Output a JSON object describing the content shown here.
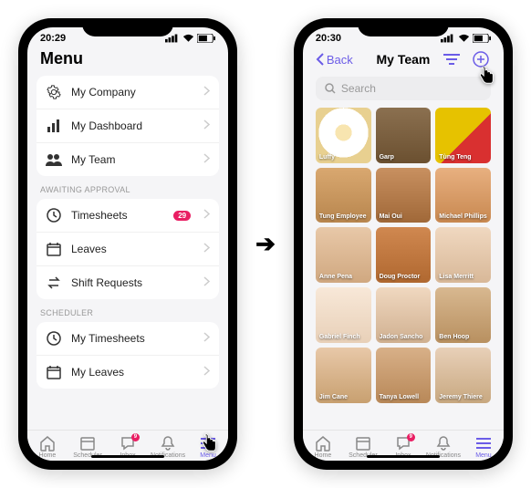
{
  "left": {
    "statusbar": {
      "time": "20:29"
    },
    "title": "Menu",
    "groups": [
      {
        "items": [
          {
            "icon": "gear",
            "label": "My Company"
          },
          {
            "icon": "bars",
            "label": "My Dashboard"
          },
          {
            "icon": "people",
            "label": "My Team"
          }
        ]
      },
      {
        "heading": "AWAITING APPROVAL",
        "items": [
          {
            "icon": "clock",
            "label": "Timesheets",
            "badge": "29"
          },
          {
            "icon": "calendar",
            "label": "Leaves"
          },
          {
            "icon": "swap",
            "label": "Shift Requests"
          }
        ]
      },
      {
        "heading": "SCHEDULER",
        "items": [
          {
            "icon": "clock",
            "label": "My Timesheets"
          },
          {
            "icon": "calendar",
            "label": "My Leaves"
          }
        ]
      }
    ]
  },
  "right": {
    "statusbar": {
      "time": "20:30"
    },
    "back": "Back",
    "title": "My Team",
    "search_placeholder": "Search",
    "members": [
      {
        "name": "Luffy"
      },
      {
        "name": "Garp"
      },
      {
        "name": "Tùng Teng"
      },
      {
        "name": "Tung Employee"
      },
      {
        "name": "Mai Oui"
      },
      {
        "name": "Michael Phillips"
      },
      {
        "name": "Anne Pena"
      },
      {
        "name": "Doug Proctor"
      },
      {
        "name": "Lisa Merritt"
      },
      {
        "name": "Gabriel Finch"
      },
      {
        "name": "Jadon Sancho"
      },
      {
        "name": "Ben Hoop"
      },
      {
        "name": "Jim Cane"
      },
      {
        "name": "Tanya Lowell"
      },
      {
        "name": "Jeremy Thiere"
      }
    ]
  },
  "tabs": [
    {
      "label": "Home"
    },
    {
      "label": "Scheduler"
    },
    {
      "label": "Inbox",
      "badge": "9"
    },
    {
      "label": "Notifications"
    },
    {
      "label": "Menu"
    }
  ]
}
